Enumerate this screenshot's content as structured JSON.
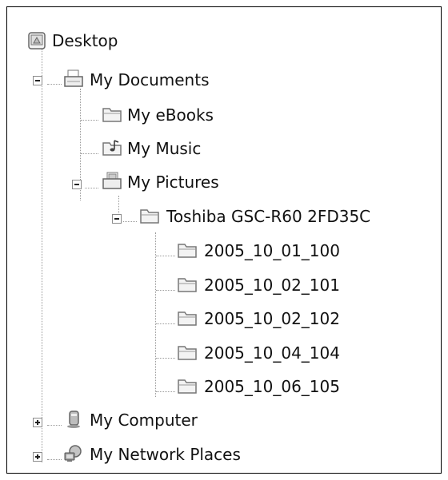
{
  "tree": {
    "desktop": {
      "label": "Desktop",
      "icon": "desktop-icon"
    },
    "my_documents": {
      "label": "My Documents",
      "icon": "documents-folder-icon",
      "expanded": true,
      "children": [
        {
          "label": "My eBooks",
          "icon": "folder-icon"
        },
        {
          "label": "My Music",
          "icon": "music-folder-icon"
        },
        {
          "label": "My Pictures",
          "icon": "pictures-folder-icon",
          "expanded": true,
          "children": [
            {
              "label": "Toshiba GSC-R60 2FD35C",
              "icon": "folder-icon",
              "expanded": true,
              "children": [
                {
                  "label": "2005_10_01_100",
                  "icon": "folder-icon"
                },
                {
                  "label": "2005_10_02_101",
                  "icon": "folder-icon"
                },
                {
                  "label": "2005_10_02_102",
                  "icon": "folder-icon"
                },
                {
                  "label": "2005_10_04_104",
                  "icon": "folder-icon"
                },
                {
                  "label": "2005_10_06_105",
                  "icon": "folder-icon"
                }
              ]
            }
          ]
        }
      ]
    },
    "my_computer": {
      "label": "My Computer",
      "icon": "computer-icon",
      "expanded": false
    },
    "my_network_places": {
      "label": "My Network Places",
      "icon": "network-icon",
      "expanded": false
    }
  },
  "colors": {
    "folder_fill": "#f3f3f3",
    "folder_stroke": "#7a7a7a",
    "tree_line": "#9a9a9a"
  }
}
